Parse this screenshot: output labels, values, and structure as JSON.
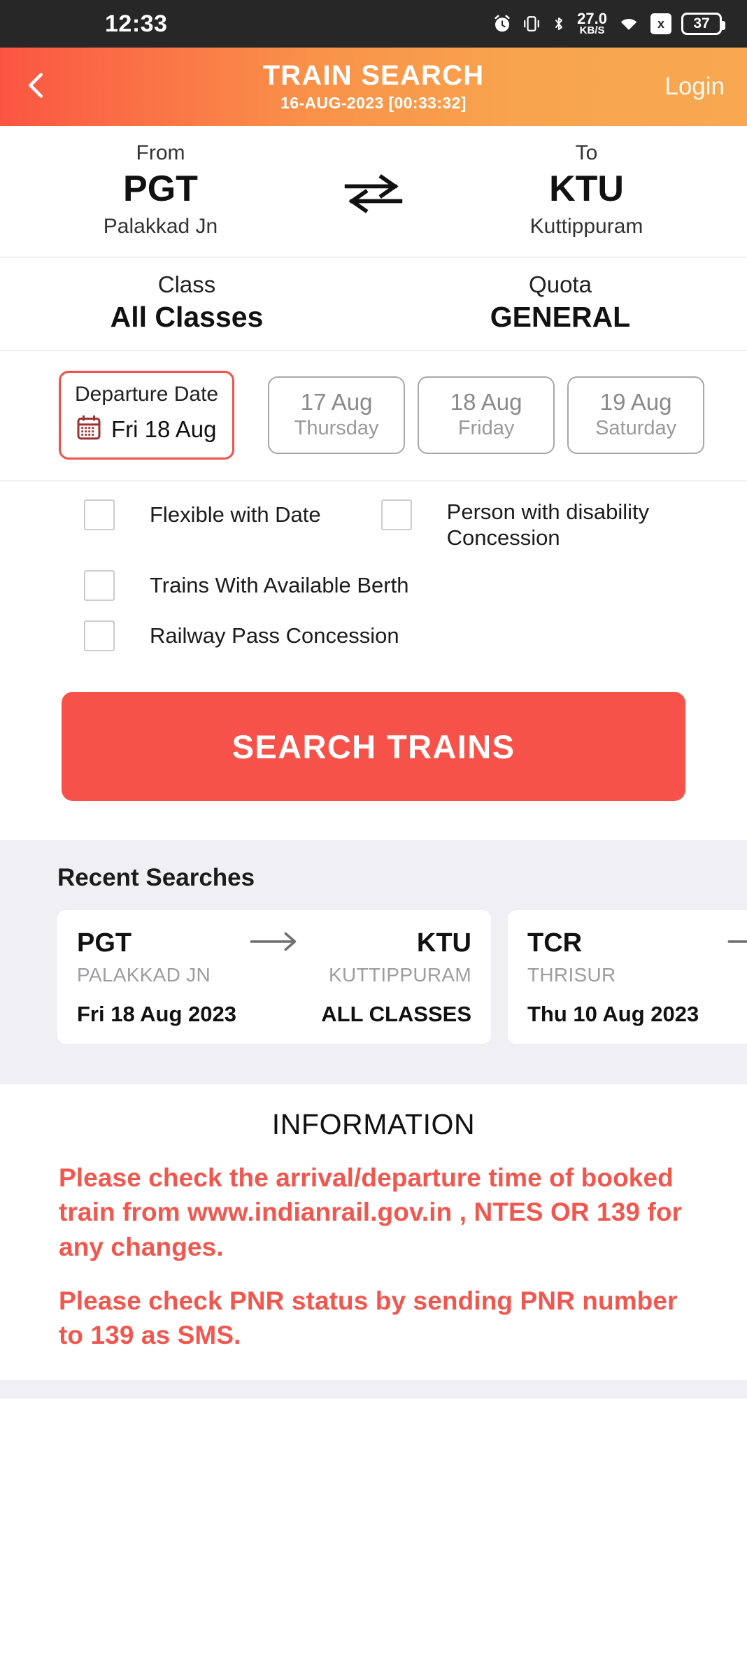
{
  "status_bar": {
    "time": "12:33",
    "network_speed_value": "27.0",
    "network_speed_unit": "KB/S",
    "sim_label": "x",
    "battery_level": "37",
    "icons": [
      "alarm-icon",
      "vibrate-icon",
      "bluetooth-icon",
      "wifi-icon",
      "sim-icon",
      "battery-icon"
    ]
  },
  "app_bar": {
    "back_icon": "chevron-left-icon",
    "title": "TRAIN SEARCH",
    "date_time": "16-AUG-2023 [00:33:32]",
    "login_label": "Login",
    "gradient_start": "#fa5542",
    "gradient_end": "#f7a851"
  },
  "journey": {
    "from": {
      "label": "From",
      "code": "PGT",
      "name": "Palakkad Jn"
    },
    "swap_icon": "swap-horizontal-icon",
    "to": {
      "label": "To",
      "code": "KTU",
      "name": "Kuttippuram"
    }
  },
  "class_quota": {
    "class": {
      "label": "Class",
      "value": "All Classes"
    },
    "quota": {
      "label": "Quota",
      "value": "GENERAL"
    }
  },
  "departure": {
    "box_title": "Departure Date",
    "calendar_icon": "calendar-icon",
    "selected_date": "Fri 18 Aug",
    "border_color": "#f0524a",
    "quick_dates": [
      {
        "date": "17 Aug",
        "weekday": "Thursday"
      },
      {
        "date": "18 Aug",
        "weekday": "Friday"
      },
      {
        "date": "19 Aug",
        "weekday": "Saturday"
      }
    ]
  },
  "options": {
    "flexible_with_date": {
      "label": "Flexible with Date",
      "checked": false
    },
    "disability_concession": {
      "label": "Person with disability Concession",
      "checked": false
    },
    "available_berth": {
      "label": "Trains With Available Berth",
      "checked": false
    },
    "railway_pass": {
      "label": "Railway Pass Concession",
      "checked": false
    }
  },
  "search_button": {
    "label": "SEARCH TRAINS",
    "color": "#f7524a"
  },
  "recent_searches": {
    "title": "Recent Searches",
    "arrow_icon": "arrow-right-icon",
    "items": [
      {
        "from_code": "PGT",
        "from_name": "PALAKKAD JN",
        "to_code": "KTU",
        "to_name": "KUTTIPPURAM",
        "date": "Fri 18 Aug 2023",
        "class": "ALL CLASSES"
      },
      {
        "from_code": "TCR",
        "from_name": "THRISUR",
        "to_code": "",
        "to_name": "",
        "date": "Thu 10 Aug 2023",
        "class": ""
      }
    ]
  },
  "information": {
    "title": "INFORMATION",
    "color": "#f0574e",
    "paragraphs": [
      "Please check the arrival/departure time of booked train from www.indianrail.gov.in , NTES OR 139 for any changes.",
      "Please check PNR status by sending PNR number to 139 as SMS."
    ]
  }
}
